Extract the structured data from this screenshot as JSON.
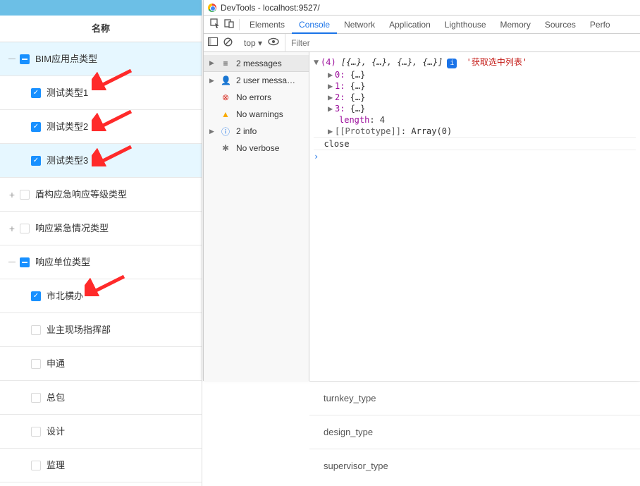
{
  "tree": {
    "header": "名称",
    "bim_root": "BIM应用点类型",
    "bim_children": [
      "测试类型1",
      "测试类型2",
      "测试类型3"
    ],
    "node2": "盾构应急响应等级类型",
    "node3": "响应紧急情况类型",
    "node4": "响应单位类型",
    "node4_children": [
      "市北横办",
      "业主现场指挥部",
      "申通",
      "总包",
      "设计",
      "监理"
    ]
  },
  "bottom": {
    "rows": [
      "turnkey_type",
      "design_type",
      "supervisor_type"
    ]
  },
  "devtools": {
    "title": "DevTools - localhost:9527/",
    "tabs": [
      "Elements",
      "Console",
      "Network",
      "Application",
      "Lighthouse",
      "Memory",
      "Sources",
      "Perfo"
    ],
    "active_tab": "Console",
    "toolbar": {
      "scope": "top",
      "scope_caret": "▾",
      "filter_placeholder": "Filter"
    },
    "sidebar": {
      "messages_count": "2 messages",
      "user_msgs": "2 user messa…",
      "no_errors": "No errors",
      "no_warnings": "No warnings",
      "info": "2 info",
      "no_verbose": "No verbose"
    },
    "console": {
      "summary_prefix": "(4)",
      "summary_body": " [{…}, {…}, {…}, {…}]",
      "red_string": "'获取选中列表'",
      "idx0": "0:",
      "idx1": "1:",
      "idx2": "2:",
      "idx3": "3:",
      "obj": "{…}",
      "length_label": "length",
      "length_val": ": 4",
      "proto_label": "[[Prototype]]",
      "proto_val": ": Array(0)",
      "close": "close"
    }
  }
}
